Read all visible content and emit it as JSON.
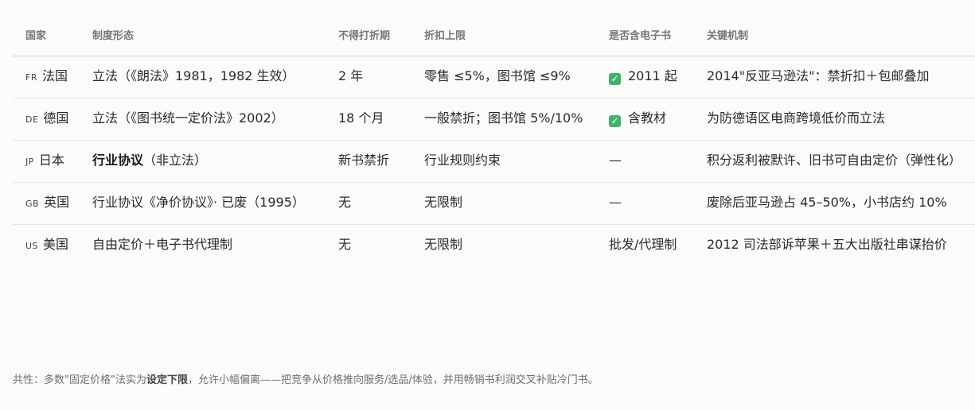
{
  "headers": [
    "国家",
    "制度形态",
    "不得打折期",
    "折扣上限",
    "是否含电子书",
    "关键机制"
  ],
  "rows": [
    {
      "code": "FR",
      "country": "法国",
      "system_bold": "",
      "system": "立法（《朗法》1981，1982 生效）",
      "period": "2 年",
      "cap": "零售 ≤5%，图书馆 ≤9%",
      "ebook_check": true,
      "ebook": "2011 起",
      "mechanism": "2014\"反亚马逊法\"：禁折扣＋包邮叠加"
    },
    {
      "code": "DE",
      "country": "德国",
      "system_bold": "",
      "system": "立法（《图书统一定价法》2002）",
      "period": "18 个月",
      "cap": "一般禁折；图书馆 5%/10%",
      "ebook_check": true,
      "ebook": "含教材",
      "mechanism": "为防德语区电商跨境低价而立法"
    },
    {
      "code": "JP",
      "country": "日本",
      "system_bold": "行业协议",
      "system": "（非立法）",
      "period": "新书禁折",
      "cap": "行业规则约束",
      "ebook_check": false,
      "ebook": "—",
      "mechanism": "积分返利被默许、旧书可自由定价（弹性化）"
    },
    {
      "code": "GB",
      "country": "英国",
      "system_bold": "",
      "system": "行业协议《净价协议》· 已废（1995）",
      "period": "无",
      "cap": "无限制",
      "ebook_check": false,
      "ebook": "—",
      "mechanism": "废除后亚马逊占 45–50%，小书店约 10%"
    },
    {
      "code": "US",
      "country": "美国",
      "system_bold": "",
      "system": "自由定价＋电子书代理制",
      "period": "无",
      "cap": "无限制",
      "ebook_check": false,
      "ebook": "批发/代理制",
      "mechanism": "2012 司法部诉苹果＋五大出版社串谋抬价"
    }
  ],
  "footnote": {
    "prefix": "共性：多数\"固定价格\"法实为",
    "bold": "设定下限",
    "suffix": "，允许小幅偏离——把竞争从价格推向服务/选品/体验，并用畅销书利润交叉补贴冷门书。"
  }
}
